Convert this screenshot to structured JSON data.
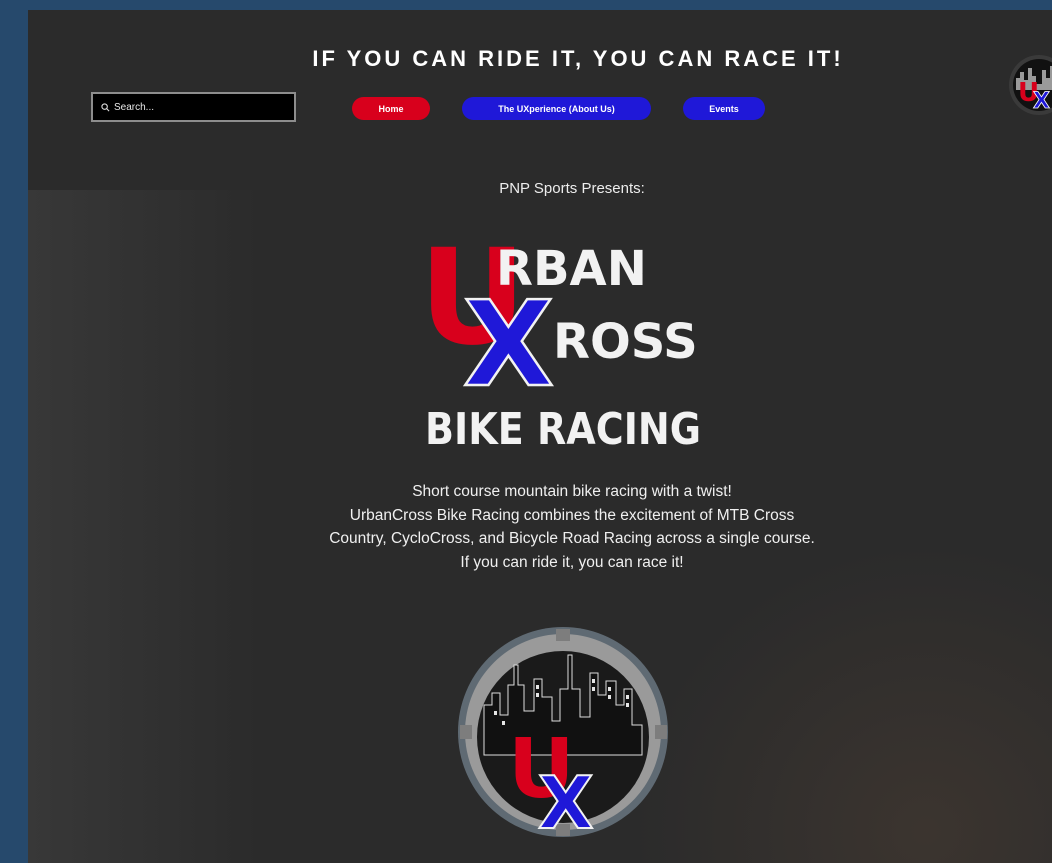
{
  "header": {
    "tagline": "IF YOU CAN RIDE IT, YOU CAN RACE IT!"
  },
  "search": {
    "placeholder": "Search..."
  },
  "nav": {
    "items": [
      {
        "label": "Home",
        "color": "#d8001c"
      },
      {
        "label": "The UXperience (About Us)",
        "color": "#1f18d8"
      },
      {
        "label": "Events",
        "color": "#1f18d8"
      }
    ]
  },
  "hero": {
    "presents": "PNP Sports Presents:",
    "logo": {
      "line1": "RBAN",
      "line2": "ROSS",
      "line3": "BIKE RACING",
      "letter_u": "U",
      "letter_x": "X",
      "red": "#d8001c",
      "blue": "#1f18d8"
    }
  },
  "description": {
    "lines": [
      "Short course mountain bike racing with a twist!",
      "UrbanCross Bike Racing combines the excitement of MTB Cross",
      "Country, CycloCross, and Bicycle Road Racing across a single course.",
      "If you can ride it, you can race it!"
    ]
  },
  "badge": {
    "letter_u": "U",
    "letter_x": "X"
  }
}
